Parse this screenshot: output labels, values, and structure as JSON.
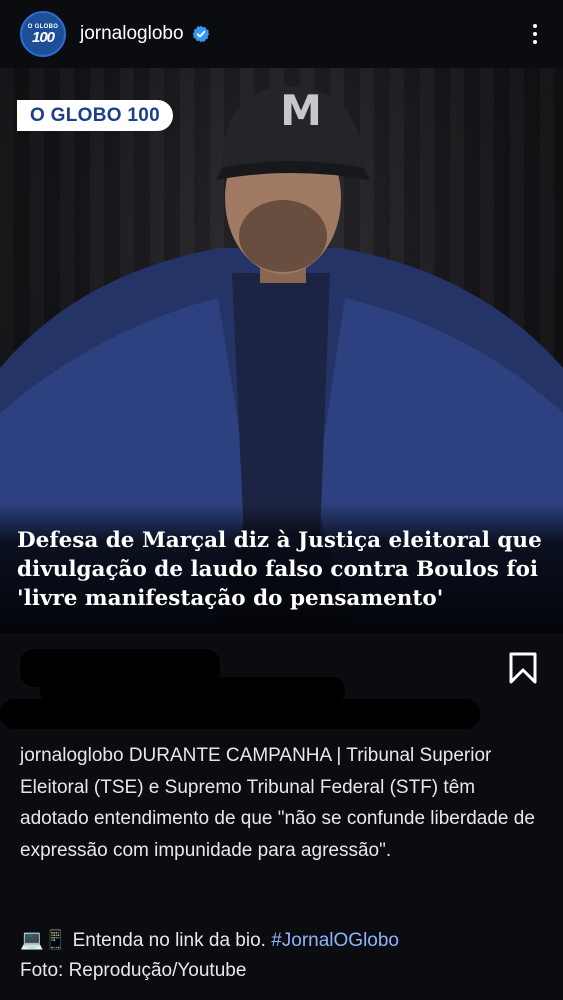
{
  "header": {
    "avatar_small": "O GLOBO",
    "avatar_big": "100",
    "username": "jornaloglobo"
  },
  "post": {
    "badge": "O GLOBO 100",
    "headline": "Defesa de Marçal diz à Justiça eleitoral que divulgação de laudo falso contra Boulos foi 'livre manifestação do pensamento'",
    "cap_logo": "M"
  },
  "caption": {
    "username": "jornaloglobo",
    "text": "DURANTE CAMPANHA | Tribunal Superior Eleitoral (TSE) e Supremo Tribunal Federal (STF) têm adotado entendimento de que \"não se confunde liberdade de expressão com impunidade para agressão\".",
    "bio_emoji": "💻📱",
    "bio_text": "Entenda no link da bio.",
    "hashtag": "#JornalOGlobo",
    "credit": "Foto: Reprodução/Youtube"
  },
  "colors": {
    "background": "#0b0c0f",
    "brand_blue": "#1a3f8c",
    "verified": "#3797f0",
    "hashtag": "#8fb3ff"
  },
  "icons": [
    "verified-badge-icon",
    "more-options-icon",
    "bookmark-icon"
  ]
}
